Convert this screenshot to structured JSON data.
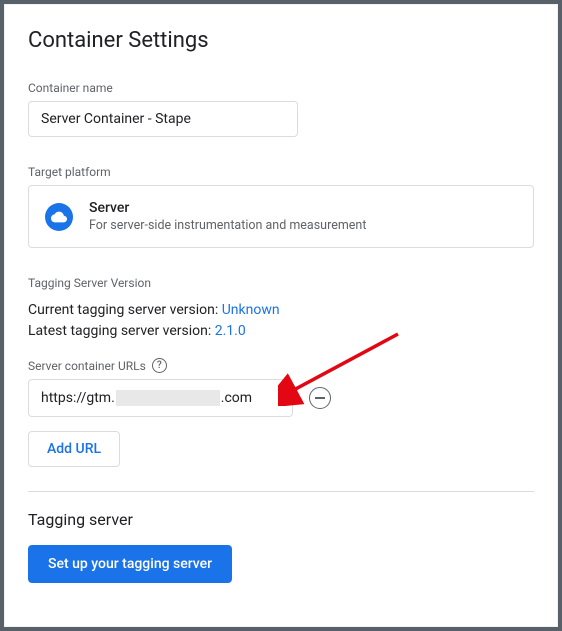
{
  "title": "Container Settings",
  "containerName": {
    "label": "Container name",
    "value": "Server Container - Stape"
  },
  "targetPlatform": {
    "label": "Target platform",
    "name": "Server",
    "description": "For server-side instrumentation and measurement"
  },
  "taggingVersion": {
    "label": "Tagging Server Version",
    "currentLabel": "Current tagging server version: ",
    "currentValue": "Unknown",
    "latestLabel": "Latest tagging server version: ",
    "latestValue": "2.1.0"
  },
  "serverUrls": {
    "label": "Server container URLs",
    "urlPrefix": "https://gtm.",
    "urlSuffix": ".com",
    "addButton": "Add URL"
  },
  "taggingServer": {
    "title": "Tagging server",
    "setupButton": "Set up your tagging server"
  }
}
